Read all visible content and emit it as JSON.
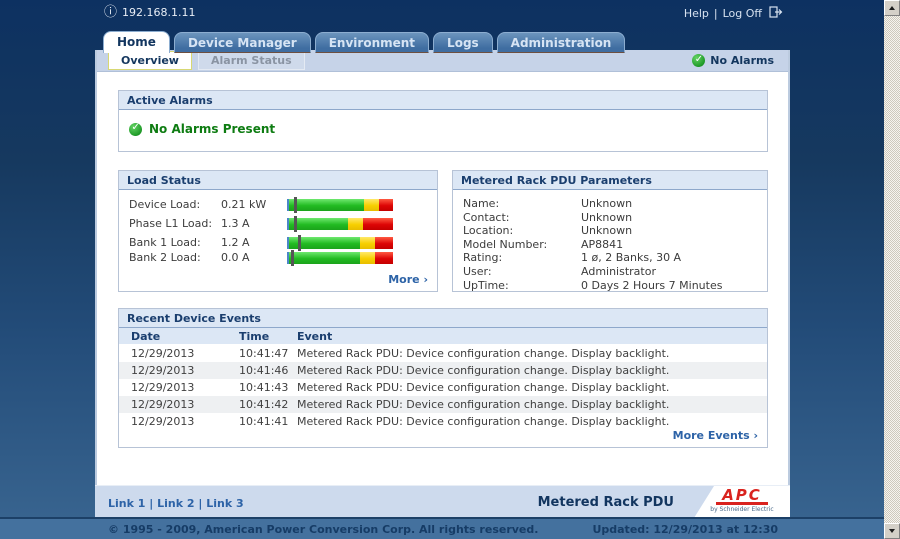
{
  "colors": {
    "accent_navy": "#12355f",
    "link_blue": "#2d63a7",
    "status_green": "#0e7c12",
    "bar_green": "#22bb22",
    "bar_yellow": "#f7cf00",
    "bar_red": "#dd0505",
    "brand_red": "#d9231f"
  },
  "header": {
    "ip_address": "192.168.1.11",
    "help": "Help",
    "separator": "|",
    "log_off": "Log Off"
  },
  "tabs": [
    {
      "label": "Home"
    },
    {
      "label": "Device Manager"
    },
    {
      "label": "Environment"
    },
    {
      "label": "Logs"
    },
    {
      "label": "Administration"
    }
  ],
  "subtabs": [
    {
      "label": "Overview"
    },
    {
      "label": "Alarm Status"
    }
  ],
  "alarm_badge": {
    "label": "No Alarms"
  },
  "active_alarms": {
    "title": "Active Alarms",
    "message": "No Alarms Present"
  },
  "load_status": {
    "title": "Load Status",
    "more": "More ›",
    "rows": [
      {
        "label": "Device Load:",
        "value": "0.21 kW",
        "green": 72,
        "yellow": 15,
        "red": 13,
        "marker": 5
      },
      {
        "label": "Phase L1 Load:",
        "value": "1.3 A",
        "green": 57,
        "yellow": 14,
        "red": 29,
        "marker": 5
      },
      {
        "label": "Bank 1 Load:",
        "value": "1.2 A",
        "green": 68,
        "yellow": 15,
        "red": 17,
        "marker": 9
      },
      {
        "label": "Bank 2 Load:",
        "value": "0.0 A",
        "green": 68,
        "yellow": 15,
        "red": 17,
        "marker": 2
      }
    ]
  },
  "parameters": {
    "title": "Metered Rack PDU Parameters",
    "rows": [
      {
        "label": "Name:",
        "value": "Unknown"
      },
      {
        "label": "Contact:",
        "value": "Unknown"
      },
      {
        "label": "Location:",
        "value": "Unknown"
      },
      {
        "label": "Model Number:",
        "value": "AP8841"
      },
      {
        "label": "Rating:",
        "value": "1 ø, 2 Banks, 30 A"
      },
      {
        "label": "User:",
        "value": "Administrator"
      },
      {
        "label": "UpTime:",
        "value": "0 Days 2 Hours 7 Minutes"
      }
    ]
  },
  "events": {
    "title": "Recent Device Events",
    "columns": [
      "Date",
      "Time",
      "Event"
    ],
    "rows": [
      [
        "12/29/2013",
        "10:41:47",
        "Metered Rack PDU: Device configuration change. Display backlight."
      ],
      [
        "12/29/2013",
        "10:41:46",
        "Metered Rack PDU: Device configuration change. Display backlight."
      ],
      [
        "12/29/2013",
        "10:41:43",
        "Metered Rack PDU: Device configuration change. Display backlight."
      ],
      [
        "12/29/2013",
        "10:41:42",
        "Metered Rack PDU: Device configuration change. Display backlight."
      ],
      [
        "12/29/2013",
        "10:41:41",
        "Metered Rack PDU: Device configuration change. Display backlight."
      ]
    ],
    "more": "More Events ›"
  },
  "footer": {
    "links": [
      "Link 1",
      "Link 2",
      "Link 3"
    ],
    "separator": "|",
    "product": "Metered Rack PDU",
    "logo": {
      "brand": "APC",
      "tagline": "by Schneider Electric"
    }
  },
  "statusbar": {
    "copyright": "© 1995 - 2009, American Power Conversion Corp. All rights reserved.",
    "updated": "Updated: 12/29/2013 at 12:30"
  }
}
